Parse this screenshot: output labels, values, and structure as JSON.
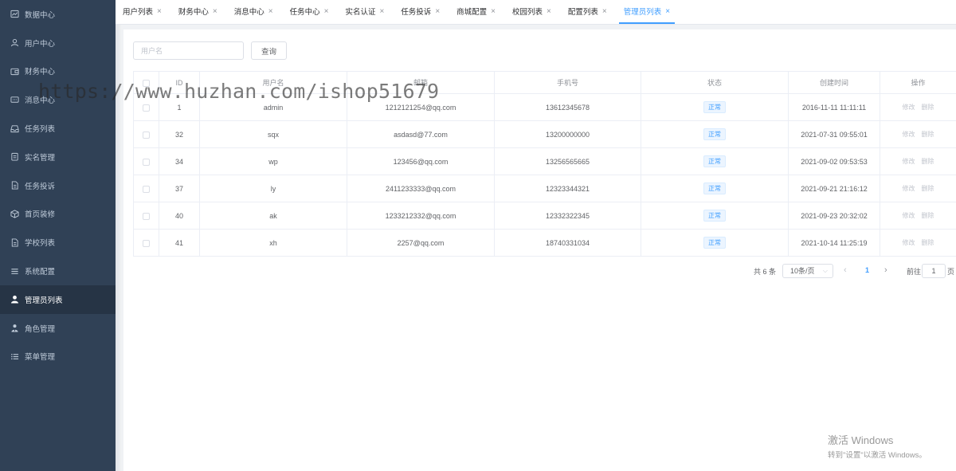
{
  "sidebar": {
    "items": [
      {
        "label": "数据中心",
        "icon": "dashboard-icon"
      },
      {
        "label": "用户中心",
        "icon": "user-icon"
      },
      {
        "label": "财务中心",
        "icon": "wallet-icon"
      },
      {
        "label": "消息中心",
        "icon": "message-icon"
      },
      {
        "label": "任务列表",
        "icon": "inbox-icon"
      },
      {
        "label": "实名管理",
        "icon": "clipboard-icon"
      },
      {
        "label": "任务投诉",
        "icon": "document-icon"
      },
      {
        "label": "首页装修",
        "icon": "box-icon"
      },
      {
        "label": "学校列表",
        "icon": "document-icon"
      },
      {
        "label": "系统配置",
        "icon": "menu-lines-icon"
      },
      {
        "label": "管理员列表",
        "icon": "admin-user-icon",
        "active": true
      },
      {
        "label": "角色管理",
        "icon": "role-icon"
      },
      {
        "label": "菜单管理",
        "icon": "list-icon"
      }
    ]
  },
  "tabs": [
    {
      "label": "用户列表"
    },
    {
      "label": "财务中心"
    },
    {
      "label": "消息中心"
    },
    {
      "label": "任务中心"
    },
    {
      "label": "实名认证"
    },
    {
      "label": "任务投诉"
    },
    {
      "label": "商城配置"
    },
    {
      "label": "校园列表"
    },
    {
      "label": "配置列表"
    },
    {
      "label": "管理员列表",
      "active": true
    }
  ],
  "search": {
    "placeholder": "用户名",
    "value": "",
    "button_label": "查询"
  },
  "table": {
    "columns": [
      "",
      "ID",
      "用户名",
      "邮箱",
      "手机号",
      "状态",
      "创建时间",
      "操作"
    ],
    "rows": [
      {
        "id": "1",
        "username": "admin",
        "email": "1212121254@qq.com",
        "phone": "13612345678",
        "status": "正常",
        "created": "2016-11-11 11:11:11"
      },
      {
        "id": "32",
        "username": "sqx",
        "email": "asdasd@77.com",
        "phone": "13200000000",
        "status": "正常",
        "created": "2021-07-31 09:55:01"
      },
      {
        "id": "34",
        "username": "wp",
        "email": "123456@qq.com",
        "phone": "13256565665",
        "status": "正常",
        "created": "2021-09-02 09:53:53"
      },
      {
        "id": "37",
        "username": "ly",
        "email": "2411233333@qq.com",
        "phone": "12323344321",
        "status": "正常",
        "created": "2021-09-21 21:16:12"
      },
      {
        "id": "40",
        "username": "ak",
        "email": "1233212332@qq.com",
        "phone": "12332322345",
        "status": "正常",
        "created": "2021-09-23 20:32:02"
      },
      {
        "id": "41",
        "username": "xh",
        "email": "2257@qq.com",
        "phone": "18740331034",
        "status": "正常",
        "created": "2021-10-14 11:25:19"
      }
    ],
    "edit_label": "修改",
    "delete_label": "删除"
  },
  "pagination": {
    "total_text": "共 6 条",
    "page_size": "10条/页",
    "current_page": "1",
    "goto_label": "前往",
    "goto_value": "1",
    "page_suffix": "页"
  },
  "watermark": "https://www.huzhan.com/ishop51679",
  "windows_activation": {
    "title": "激活 Windows",
    "subtitle": "转到\"设置\"以激活 Windows。"
  },
  "colors": {
    "sidebar_bg": "#304156",
    "sidebar_active_bg": "#263445",
    "accent": "#409eff"
  }
}
